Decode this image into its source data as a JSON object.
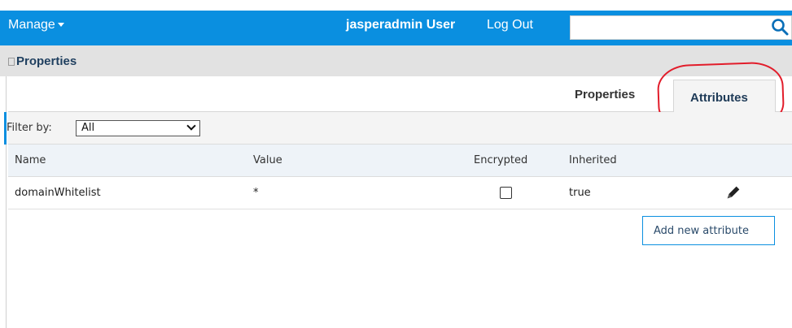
{
  "header": {
    "manage_label": "Manage",
    "user_label": "jasperadmin User",
    "logout_label": "Log Out",
    "search_value": ""
  },
  "panel": {
    "title": "Properties"
  },
  "tabs": [
    {
      "label": "Properties",
      "selected": false
    },
    {
      "label": "Attributes",
      "selected": true
    }
  ],
  "filter": {
    "label": "Filter by:",
    "selected": "All"
  },
  "table": {
    "columns": [
      "Name",
      "Value",
      "Encrypted",
      "Inherited"
    ],
    "rows": [
      {
        "name": "domainWhitelist",
        "value": "*",
        "encrypted": false,
        "inherited": "true"
      }
    ]
  },
  "actions": {
    "add_label": "Add new attribute"
  },
  "colors": {
    "header_blue": "#0a8fe0",
    "highlight_red": "#e21d2b"
  }
}
